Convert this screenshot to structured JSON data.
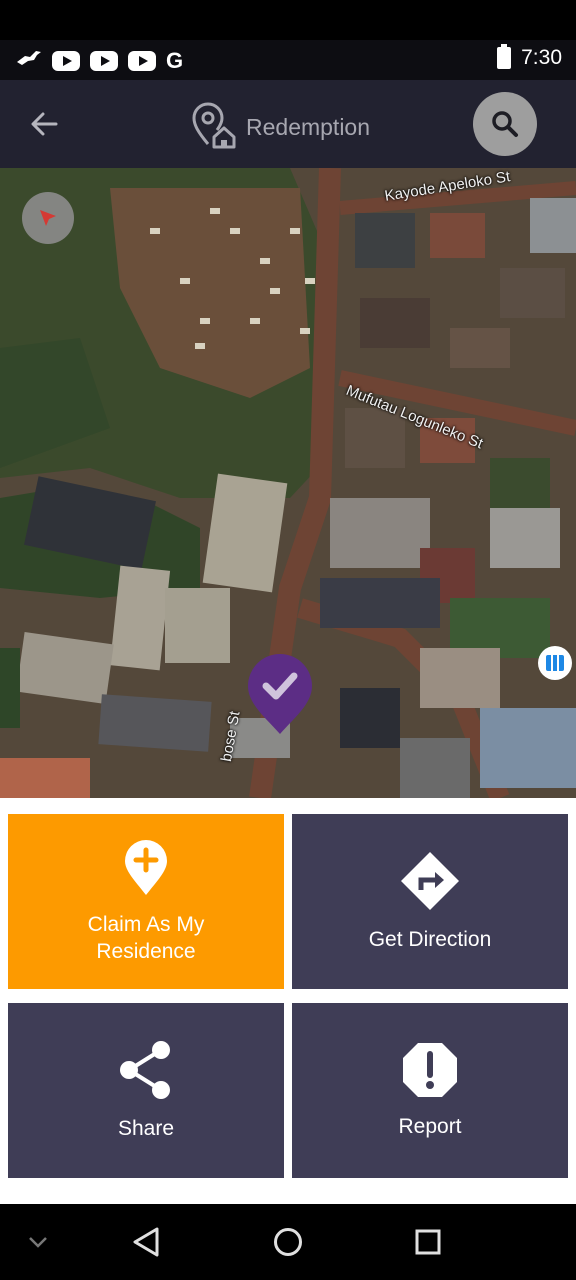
{
  "status_bar": {
    "time": "7:30",
    "notification_icons": [
      "bird-icon",
      "youtube-icon",
      "youtube-icon",
      "youtube-icon",
      "google-icon"
    ],
    "google_glyph": "G",
    "battery_icon": "battery-icon"
  },
  "app_bar": {
    "back_icon": "arrow-left-icon",
    "title_icon": "location-home-icon",
    "title": "Redemption",
    "search_icon": "search-icon"
  },
  "map": {
    "streets": {
      "kayode": "Kayode Apeloko St",
      "mufutau": "Mufutau Logunleko St",
      "partial": "bose St"
    },
    "marker_icon": "check-pin-icon",
    "compass_icon": "compass-icon"
  },
  "actions": {
    "claim": {
      "label": "Claim As My Residence",
      "icon": "pin-plus-icon"
    },
    "direction": {
      "label": "Get Direction",
      "icon": "direction-sign-icon"
    },
    "share": {
      "label": "Share",
      "icon": "share-icon"
    },
    "report": {
      "label": "Report",
      "icon": "report-exclamation-icon"
    }
  },
  "colors": {
    "claim_tile": "#fd9a00",
    "tile": "#3f3d56",
    "app_bar": "#222230",
    "marker": "#5c2d85"
  },
  "nav_bar": {
    "items": [
      "chevron-down-icon",
      "back-triangle-icon",
      "home-circle-icon",
      "recents-square-icon"
    ]
  }
}
